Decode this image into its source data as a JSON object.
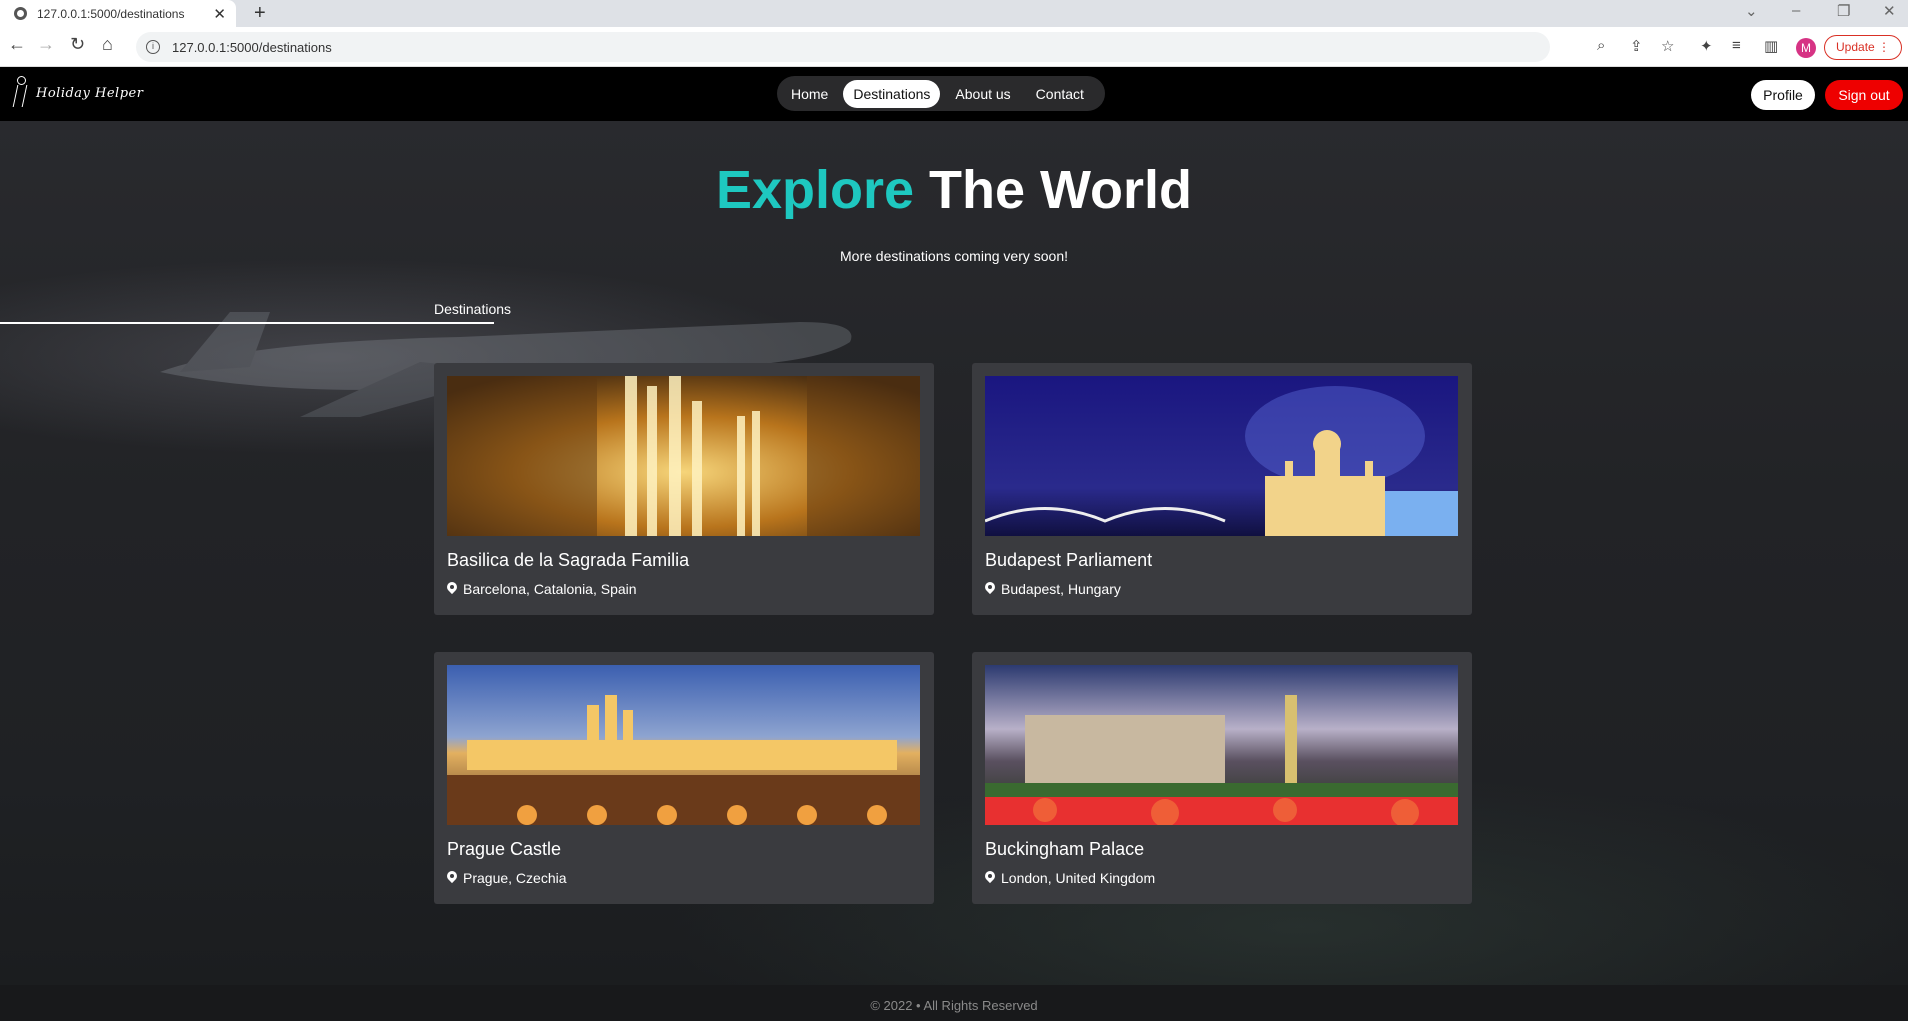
{
  "browser": {
    "tab_title": "127.0.0.1:5000/destinations",
    "url": "127.0.0.1:5000/destinations",
    "profile_initial": "M",
    "update_label": "Update"
  },
  "site": {
    "brand": "Holiday Helper",
    "nav": [
      {
        "label": "Home",
        "active": false
      },
      {
        "label": "Destinations",
        "active": true
      },
      {
        "label": "About us",
        "active": false
      },
      {
        "label": "Contact",
        "active": false
      }
    ],
    "profile_label": "Profile",
    "signout_label": "Sign out"
  },
  "hero": {
    "title_accent": "Explore",
    "title_rest": "The World",
    "subtitle": "More destinations coming very soon!"
  },
  "section": {
    "label": "Destinations"
  },
  "destinations": [
    {
      "title": "Basilica de la Sagrada Familia",
      "location": "Barcelona, Catalonia, Spain"
    },
    {
      "title": "Budapest Parliament",
      "location": "Budapest, Hungary"
    },
    {
      "title": "Prague Castle",
      "location": "Prague, Czechia"
    },
    {
      "title": "Buckingham Palace",
      "location": "London, United Kingdom"
    }
  ],
  "footer": {
    "text": "© 2022 • All Rights Reserved"
  },
  "colors": {
    "accent": "#1ec8c0",
    "signout": "#ee0000"
  }
}
